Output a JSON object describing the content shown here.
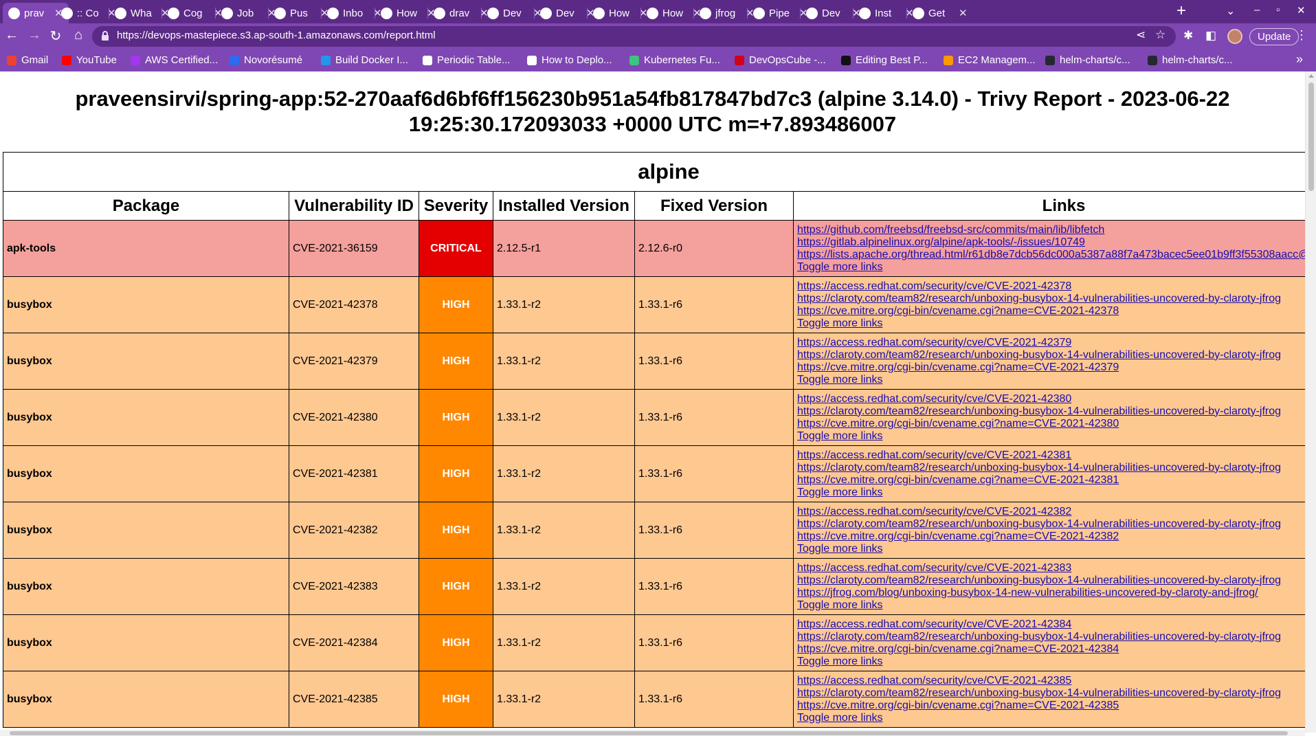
{
  "browser": {
    "tabs": [
      {
        "title": "prav",
        "icon": "globe-icon",
        "active": true
      },
      {
        "title": ":: Co",
        "icon": "globe-icon"
      },
      {
        "title": "Wha",
        "icon": "whatsapp-icon"
      },
      {
        "title": "Cog",
        "icon": "fc-icon"
      },
      {
        "title": "Job",
        "icon": "star-icon"
      },
      {
        "title": "Pus",
        "icon": "chatgpt-icon"
      },
      {
        "title": "Inbo",
        "icon": "gmail-icon"
      },
      {
        "title": "How",
        "icon": "youtube-icon"
      },
      {
        "title": "drav",
        "icon": "drawio-icon"
      },
      {
        "title": "Dev",
        "icon": "github-icon"
      },
      {
        "title": "Dev",
        "icon": "github-icon"
      },
      {
        "title": "How",
        "icon": "github-icon"
      },
      {
        "title": "How",
        "icon": "youtube-icon"
      },
      {
        "title": "jfrog",
        "icon": "jfrog-icon"
      },
      {
        "title": "Pipe",
        "icon": "jenkins-icon"
      },
      {
        "title": "Dev",
        "icon": "github-icon"
      },
      {
        "title": "Inst",
        "icon": "box-icon"
      },
      {
        "title": "Get",
        "icon": "gitlab-icon"
      }
    ],
    "url": "https://devops-mastepiece.s3.ap-south-1.amazonaws.com/report.html",
    "update_label": "Update",
    "bookmarks": [
      {
        "label": "Gmail",
        "icon": "gmail-icon"
      },
      {
        "label": "YouTube",
        "icon": "youtube-icon"
      },
      {
        "label": "AWS Certified...",
        "icon": "udemy-icon"
      },
      {
        "label": "Novorésumé",
        "icon": "novoresume-icon"
      },
      {
        "label": "Build Docker I...",
        "icon": "docker-icon"
      },
      {
        "label": "Periodic Table...",
        "icon": "periodic-table-icon"
      },
      {
        "label": "How to Deplo...",
        "icon": "page-icon"
      },
      {
        "label": "Kubernetes Fu...",
        "icon": "kubernetes-icon"
      },
      {
        "label": "DevOpsCube -...",
        "icon": "devopscube-icon"
      },
      {
        "label": "Editing Best P...",
        "icon": "medium-icon"
      },
      {
        "label": "EC2 Managem...",
        "icon": "aws-icon"
      },
      {
        "label": "helm-charts/c...",
        "icon": "github-icon"
      },
      {
        "label": "helm-charts/c...",
        "icon": "github-icon"
      }
    ]
  },
  "report": {
    "title": "praveensirvi/spring-app:52-270aaf6d6bf6ff156230b951a54fb817847bd7c3 (alpine 3.14.0) - Trivy Report - 2023-06-22 19:25:30.172093033 +0000 UTC m=+7.893486007",
    "group": "alpine",
    "columns": [
      "Package",
      "Vulnerability ID",
      "Severity",
      "Installed Version",
      "Fixed Version",
      "Links"
    ],
    "toggle_label": "Toggle more links",
    "rows": [
      {
        "package": "apk-tools",
        "vuln_id": "CVE-2021-36159",
        "severity": "CRITICAL",
        "installed": "2.12.5-r1",
        "fixed": "2.12.6-r0",
        "links": [
          "https://github.com/freebsd/freebsd-src/commits/main/lib/libfetch",
          "https://gitlab.alpinelinux.org/alpine/apk-tools/-/issues/10749",
          "https://lists.apache.org/thread.html/r61db8e7dcb56dc000a5387a88f7a473bacec5ee01b9ff3f55308aacc@"
        ]
      },
      {
        "package": "busybox",
        "vuln_id": "CVE-2021-42378",
        "severity": "HIGH",
        "installed": "1.33.1-r2",
        "fixed": "1.33.1-r6",
        "links": [
          "https://access.redhat.com/security/cve/CVE-2021-42378",
          "https://claroty.com/team82/research/unboxing-busybox-14-vulnerabilities-uncovered-by-claroty-jfrog",
          "https://cve.mitre.org/cgi-bin/cvename.cgi?name=CVE-2021-42378"
        ]
      },
      {
        "package": "busybox",
        "vuln_id": "CVE-2021-42379",
        "severity": "HIGH",
        "installed": "1.33.1-r2",
        "fixed": "1.33.1-r6",
        "links": [
          "https://access.redhat.com/security/cve/CVE-2021-42379",
          "https://claroty.com/team82/research/unboxing-busybox-14-vulnerabilities-uncovered-by-claroty-jfrog",
          "https://cve.mitre.org/cgi-bin/cvename.cgi?name=CVE-2021-42379"
        ]
      },
      {
        "package": "busybox",
        "vuln_id": "CVE-2021-42380",
        "severity": "HIGH",
        "installed": "1.33.1-r2",
        "fixed": "1.33.1-r6",
        "links": [
          "https://access.redhat.com/security/cve/CVE-2021-42380",
          "https://claroty.com/team82/research/unboxing-busybox-14-vulnerabilities-uncovered-by-claroty-jfrog",
          "https://cve.mitre.org/cgi-bin/cvename.cgi?name=CVE-2021-42380"
        ]
      },
      {
        "package": "busybox",
        "vuln_id": "CVE-2021-42381",
        "severity": "HIGH",
        "installed": "1.33.1-r2",
        "fixed": "1.33.1-r6",
        "links": [
          "https://access.redhat.com/security/cve/CVE-2021-42381",
          "https://claroty.com/team82/research/unboxing-busybox-14-vulnerabilities-uncovered-by-claroty-jfrog",
          "https://cve.mitre.org/cgi-bin/cvename.cgi?name=CVE-2021-42381"
        ]
      },
      {
        "package": "busybox",
        "vuln_id": "CVE-2021-42382",
        "severity": "HIGH",
        "installed": "1.33.1-r2",
        "fixed": "1.33.1-r6",
        "links": [
          "https://access.redhat.com/security/cve/CVE-2021-42382",
          "https://claroty.com/team82/research/unboxing-busybox-14-vulnerabilities-uncovered-by-claroty-jfrog",
          "https://cve.mitre.org/cgi-bin/cvename.cgi?name=CVE-2021-42382"
        ]
      },
      {
        "package": "busybox",
        "vuln_id": "CVE-2021-42383",
        "severity": "HIGH",
        "installed": "1.33.1-r2",
        "fixed": "1.33.1-r6",
        "links": [
          "https://access.redhat.com/security/cve/CVE-2021-42383",
          "https://claroty.com/team82/research/unboxing-busybox-14-vulnerabilities-uncovered-by-claroty-jfrog",
          "https://jfrog.com/blog/unboxing-busybox-14-new-vulnerabilities-uncovered-by-claroty-and-jfrog/"
        ]
      },
      {
        "package": "busybox",
        "vuln_id": "CVE-2021-42384",
        "severity": "HIGH",
        "installed": "1.33.1-r2",
        "fixed": "1.33.1-r6",
        "links": [
          "https://access.redhat.com/security/cve/CVE-2021-42384",
          "https://claroty.com/team82/research/unboxing-busybox-14-vulnerabilities-uncovered-by-claroty-jfrog",
          "https://cve.mitre.org/cgi-bin/cvename.cgi?name=CVE-2021-42384"
        ]
      },
      {
        "package": "busybox",
        "vuln_id": "CVE-2021-42385",
        "severity": "HIGH",
        "installed": "1.33.1-r2",
        "fixed": "1.33.1-r6",
        "links": [
          "https://access.redhat.com/security/cve/CVE-2021-42385",
          "https://claroty.com/team82/research/unboxing-busybox-14-vulnerabilities-uncovered-by-claroty-jfrog",
          "https://cve.mitre.org/cgi-bin/cvename.cgi?name=CVE-2021-42385"
        ]
      }
    ]
  },
  "colors": {
    "tabstrip": "#5b2a86",
    "toolbar": "#7f47b3",
    "critical_row": "#f4a09c",
    "critical_cell": "#e40000",
    "high_row": "#fec891",
    "high_cell": "#ff8800",
    "link": "#1a0dab"
  }
}
